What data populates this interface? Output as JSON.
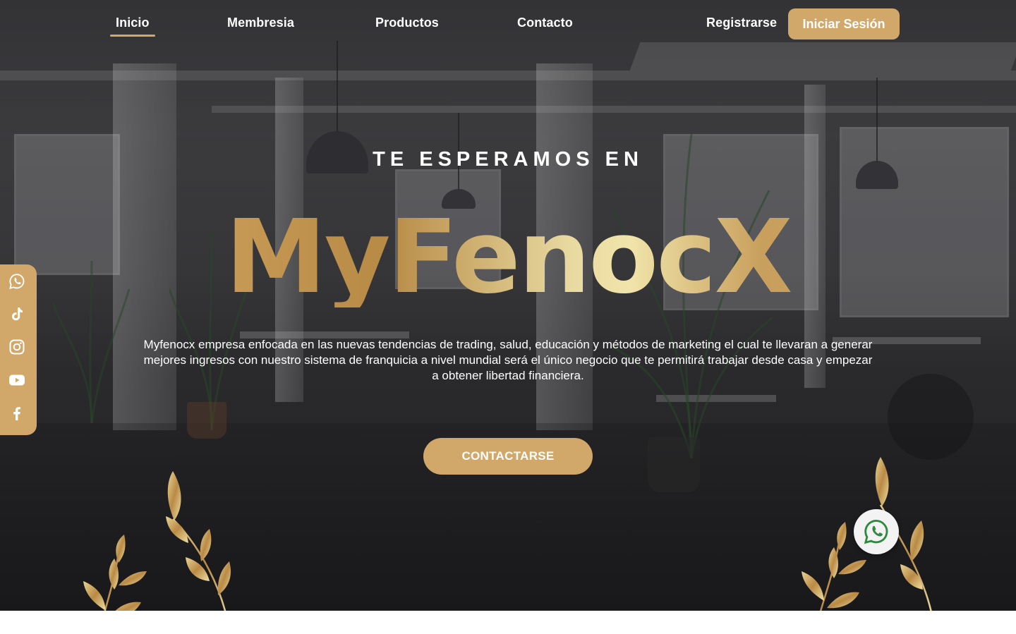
{
  "nav": {
    "links": [
      {
        "label": "Inicio",
        "active": true
      },
      {
        "label": "Membresia",
        "active": false
      },
      {
        "label": "Productos",
        "active": false
      },
      {
        "label": "Contacto",
        "active": false
      }
    ],
    "register_label": "Registrarse",
    "login_label": "Iniciar Sesión"
  },
  "hero": {
    "eyebrow": "TE ESPERAMOS EN",
    "brand": "MyFenocX",
    "description": "Myfenocx empresa enfocada en las nuevas tendencias de trading, salud, educación y métodos de marketing el cual te llevaran a generar mejores ingresos con nuestro sistema de franquicia a nivel mundial será el único negocio que te permitirá trabajar desde casa y empezar a obtener libertad financiera.",
    "cta_label": "CONTACTARSE"
  },
  "social": [
    "whatsapp-icon",
    "tiktok-icon",
    "instagram-icon",
    "youtube-icon",
    "facebook-icon"
  ],
  "colors": {
    "accent": "#d2a76a",
    "gold_light": "#f1e4aa",
    "whatsapp_green": "#2e8b3e"
  }
}
